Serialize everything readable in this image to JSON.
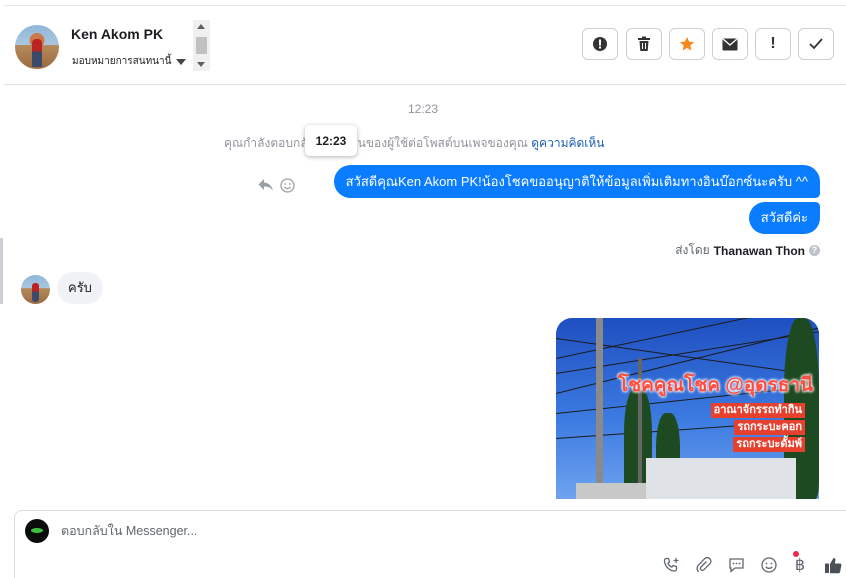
{
  "header": {
    "contact_name": "Ken Akom PK",
    "assign_label": "มอบหมายการสนทนานี้",
    "toolbar": [
      {
        "name": "report-button",
        "icon": "alert-circle-icon",
        "glyph": "❗"
      },
      {
        "name": "delete-button",
        "icon": "trash-icon",
        "glyph": "🗑"
      },
      {
        "name": "star-button",
        "icon": "star-icon",
        "glyph": "★"
      },
      {
        "name": "mark-unread-button",
        "icon": "envelope-icon",
        "glyph": "✉"
      },
      {
        "name": "important-button",
        "icon": "exclamation-icon",
        "glyph": "!"
      },
      {
        "name": "mark-done-button",
        "icon": "checkmark-icon",
        "glyph": "✓"
      }
    ]
  },
  "conversation": {
    "timestamp": "12:23",
    "context_prefix": "คุณกำลังตอบกลั",
    "context_suffix": "เห็นของผู้ใช้ต่อโพสต์บนเพจของคุณ",
    "context_link": "ดูความคิดเห็น",
    "tooltip": "12:23",
    "outgoing": [
      "สวัสดีคุณKen Akom PK!น้องโชคขออนุญาติให้ข้อมูลเพิ่มเติมทางอินบ๊อกซ์นะครับ ^^",
      "สวัสดีค่ะ"
    ],
    "sent_by_label": "ส่งโดย",
    "sent_by_name": "Thanawan Thon",
    "incoming": "ครับ",
    "image_text": {
      "title": "โชคคูณโชค @อุดรธานี",
      "line1": "อาณาจักรรถทำกิน",
      "line2": "รถกระบะคอก",
      "line3": "รถกระบะดั้มพ์"
    }
  },
  "composer": {
    "placeholder": "ตอบกลับใน Messenger...",
    "icons": [
      "add-call-icon",
      "paperclip-icon",
      "saved-replies-icon",
      "emoji-icon",
      "baht-payment-icon",
      "thumbs-up-icon"
    ],
    "baht_symbol": "฿"
  },
  "colors": {
    "accent": "#0a7cff",
    "incoming_bubble": "#f0f2f5",
    "notification": "#f02849"
  }
}
